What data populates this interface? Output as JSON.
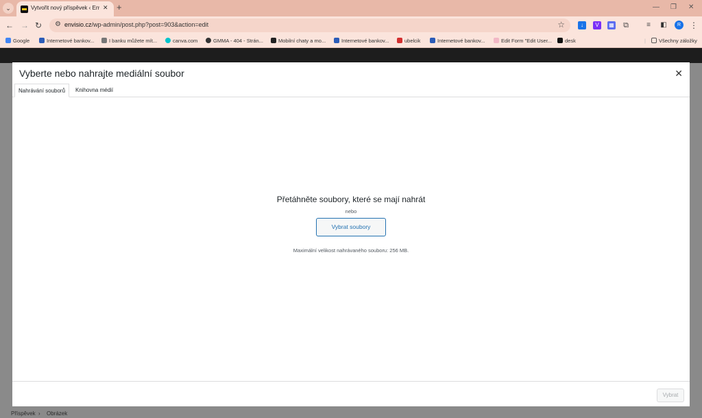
{
  "browser": {
    "tab_title": "Vytvořit nový příspěvek ‹ Envisi",
    "url_host": "envisio.cz",
    "url_path": "/wp-admin/post.php?post=903&action=edit",
    "profile_initial": "R"
  },
  "bookmarks": [
    {
      "label": "Google",
      "icon": "google-icon"
    },
    {
      "label": "Internetové bankov...",
      "icon": "bank-icon"
    },
    {
      "label": "I banku můžete mít...",
      "icon": "link-icon"
    },
    {
      "label": "canva.com",
      "icon": "canva-icon"
    },
    {
      "label": "GMMA - 404 - Strán...",
      "icon": "globe-icon"
    },
    {
      "label": "Mobilní chaty a mo...",
      "icon": "chat-icon"
    },
    {
      "label": "Internetové bankov...",
      "icon": "bank-icon"
    },
    {
      "label": "ubelcik",
      "icon": "bird-icon"
    },
    {
      "label": "Internetové bankov...",
      "icon": "bank-icon"
    },
    {
      "label": "Edit Form \"Edit User...",
      "icon": "form-icon"
    },
    {
      "label": "desk",
      "icon": "desk-icon"
    }
  ],
  "all_bookmarks": "Všechny záložky",
  "modal": {
    "title": "Vyberte nebo nahrajte mediální soubor",
    "tabs": [
      "Nahrávání souborů",
      "Knihovna médií"
    ],
    "drop_title": "Přetáhněte soubory, které se mají nahrát",
    "or_text": "nebo",
    "select_button": "Vybrat soubory",
    "max_size": "Maximální velikost nahrávaného souboru: 256 MB.",
    "choose_button": "Vybrat"
  },
  "breadcrumb": [
    "Příspěvek",
    "Obrázek"
  ]
}
